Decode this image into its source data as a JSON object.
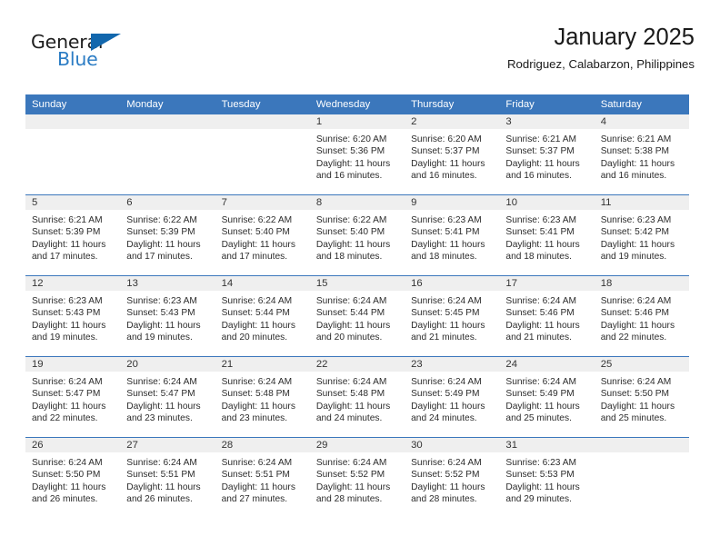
{
  "brand": {
    "name_part1": "General",
    "name_part2": "Blue",
    "triangle_color": "#1267ad",
    "blue_text_color": "#2b7cc4"
  },
  "header": {
    "title": "January 2025",
    "subtitle": "Rodriguez, Calabarzon, Philippines"
  },
  "theme": {
    "header_blue": "#3b77bc",
    "daynum_band": "#efefef"
  },
  "weekday_headers": [
    "Sunday",
    "Monday",
    "Tuesday",
    "Wednesday",
    "Thursday",
    "Friday",
    "Saturday"
  ],
  "labels": {
    "sunrise_prefix": "Sunrise:",
    "sunset_prefix": "Sunset:",
    "daylight_prefix": "Daylight:"
  },
  "weeks": [
    [
      {
        "day": "",
        "empty": true
      },
      {
        "day": "",
        "empty": true
      },
      {
        "day": "",
        "empty": true
      },
      {
        "day": "1",
        "sunrise": "Sunrise: 6:20 AM",
        "sunset": "Sunset: 5:36 PM",
        "daylight_line1": "Daylight: 11 hours",
        "daylight_line2": "and 16 minutes."
      },
      {
        "day": "2",
        "sunrise": "Sunrise: 6:20 AM",
        "sunset": "Sunset: 5:37 PM",
        "daylight_line1": "Daylight: 11 hours",
        "daylight_line2": "and 16 minutes."
      },
      {
        "day": "3",
        "sunrise": "Sunrise: 6:21 AM",
        "sunset": "Sunset: 5:37 PM",
        "daylight_line1": "Daylight: 11 hours",
        "daylight_line2": "and 16 minutes."
      },
      {
        "day": "4",
        "sunrise": "Sunrise: 6:21 AM",
        "sunset": "Sunset: 5:38 PM",
        "daylight_line1": "Daylight: 11 hours",
        "daylight_line2": "and 16 minutes."
      }
    ],
    [
      {
        "day": "5",
        "sunrise": "Sunrise: 6:21 AM",
        "sunset": "Sunset: 5:39 PM",
        "daylight_line1": "Daylight: 11 hours",
        "daylight_line2": "and 17 minutes."
      },
      {
        "day": "6",
        "sunrise": "Sunrise: 6:22 AM",
        "sunset": "Sunset: 5:39 PM",
        "daylight_line1": "Daylight: 11 hours",
        "daylight_line2": "and 17 minutes."
      },
      {
        "day": "7",
        "sunrise": "Sunrise: 6:22 AM",
        "sunset": "Sunset: 5:40 PM",
        "daylight_line1": "Daylight: 11 hours",
        "daylight_line2": "and 17 minutes."
      },
      {
        "day": "8",
        "sunrise": "Sunrise: 6:22 AM",
        "sunset": "Sunset: 5:40 PM",
        "daylight_line1": "Daylight: 11 hours",
        "daylight_line2": "and 18 minutes."
      },
      {
        "day": "9",
        "sunrise": "Sunrise: 6:23 AM",
        "sunset": "Sunset: 5:41 PM",
        "daylight_line1": "Daylight: 11 hours",
        "daylight_line2": "and 18 minutes."
      },
      {
        "day": "10",
        "sunrise": "Sunrise: 6:23 AM",
        "sunset": "Sunset: 5:41 PM",
        "daylight_line1": "Daylight: 11 hours",
        "daylight_line2": "and 18 minutes."
      },
      {
        "day": "11",
        "sunrise": "Sunrise: 6:23 AM",
        "sunset": "Sunset: 5:42 PM",
        "daylight_line1": "Daylight: 11 hours",
        "daylight_line2": "and 19 minutes."
      }
    ],
    [
      {
        "day": "12",
        "sunrise": "Sunrise: 6:23 AM",
        "sunset": "Sunset: 5:43 PM",
        "daylight_line1": "Daylight: 11 hours",
        "daylight_line2": "and 19 minutes."
      },
      {
        "day": "13",
        "sunrise": "Sunrise: 6:23 AM",
        "sunset": "Sunset: 5:43 PM",
        "daylight_line1": "Daylight: 11 hours",
        "daylight_line2": "and 19 minutes."
      },
      {
        "day": "14",
        "sunrise": "Sunrise: 6:24 AM",
        "sunset": "Sunset: 5:44 PM",
        "daylight_line1": "Daylight: 11 hours",
        "daylight_line2": "and 20 minutes."
      },
      {
        "day": "15",
        "sunrise": "Sunrise: 6:24 AM",
        "sunset": "Sunset: 5:44 PM",
        "daylight_line1": "Daylight: 11 hours",
        "daylight_line2": "and 20 minutes."
      },
      {
        "day": "16",
        "sunrise": "Sunrise: 6:24 AM",
        "sunset": "Sunset: 5:45 PM",
        "daylight_line1": "Daylight: 11 hours",
        "daylight_line2": "and 21 minutes."
      },
      {
        "day": "17",
        "sunrise": "Sunrise: 6:24 AM",
        "sunset": "Sunset: 5:46 PM",
        "daylight_line1": "Daylight: 11 hours",
        "daylight_line2": "and 21 minutes."
      },
      {
        "day": "18",
        "sunrise": "Sunrise: 6:24 AM",
        "sunset": "Sunset: 5:46 PM",
        "daylight_line1": "Daylight: 11 hours",
        "daylight_line2": "and 22 minutes."
      }
    ],
    [
      {
        "day": "19",
        "sunrise": "Sunrise: 6:24 AM",
        "sunset": "Sunset: 5:47 PM",
        "daylight_line1": "Daylight: 11 hours",
        "daylight_line2": "and 22 minutes."
      },
      {
        "day": "20",
        "sunrise": "Sunrise: 6:24 AM",
        "sunset": "Sunset: 5:47 PM",
        "daylight_line1": "Daylight: 11 hours",
        "daylight_line2": "and 23 minutes."
      },
      {
        "day": "21",
        "sunrise": "Sunrise: 6:24 AM",
        "sunset": "Sunset: 5:48 PM",
        "daylight_line1": "Daylight: 11 hours",
        "daylight_line2": "and 23 minutes."
      },
      {
        "day": "22",
        "sunrise": "Sunrise: 6:24 AM",
        "sunset": "Sunset: 5:48 PM",
        "daylight_line1": "Daylight: 11 hours",
        "daylight_line2": "and 24 minutes."
      },
      {
        "day": "23",
        "sunrise": "Sunrise: 6:24 AM",
        "sunset": "Sunset: 5:49 PM",
        "daylight_line1": "Daylight: 11 hours",
        "daylight_line2": "and 24 minutes."
      },
      {
        "day": "24",
        "sunrise": "Sunrise: 6:24 AM",
        "sunset": "Sunset: 5:49 PM",
        "daylight_line1": "Daylight: 11 hours",
        "daylight_line2": "and 25 minutes."
      },
      {
        "day": "25",
        "sunrise": "Sunrise: 6:24 AM",
        "sunset": "Sunset: 5:50 PM",
        "daylight_line1": "Daylight: 11 hours",
        "daylight_line2": "and 25 minutes."
      }
    ],
    [
      {
        "day": "26",
        "sunrise": "Sunrise: 6:24 AM",
        "sunset": "Sunset: 5:50 PM",
        "daylight_line1": "Daylight: 11 hours",
        "daylight_line2": "and 26 minutes."
      },
      {
        "day": "27",
        "sunrise": "Sunrise: 6:24 AM",
        "sunset": "Sunset: 5:51 PM",
        "daylight_line1": "Daylight: 11 hours",
        "daylight_line2": "and 26 minutes."
      },
      {
        "day": "28",
        "sunrise": "Sunrise: 6:24 AM",
        "sunset": "Sunset: 5:51 PM",
        "daylight_line1": "Daylight: 11 hours",
        "daylight_line2": "and 27 minutes."
      },
      {
        "day": "29",
        "sunrise": "Sunrise: 6:24 AM",
        "sunset": "Sunset: 5:52 PM",
        "daylight_line1": "Daylight: 11 hours",
        "daylight_line2": "and 28 minutes."
      },
      {
        "day": "30",
        "sunrise": "Sunrise: 6:24 AM",
        "sunset": "Sunset: 5:52 PM",
        "daylight_line1": "Daylight: 11 hours",
        "daylight_line2": "and 28 minutes."
      },
      {
        "day": "31",
        "sunrise": "Sunrise: 6:23 AM",
        "sunset": "Sunset: 5:53 PM",
        "daylight_line1": "Daylight: 11 hours",
        "daylight_line2": "and 29 minutes."
      },
      {
        "day": "",
        "empty": true
      }
    ]
  ]
}
